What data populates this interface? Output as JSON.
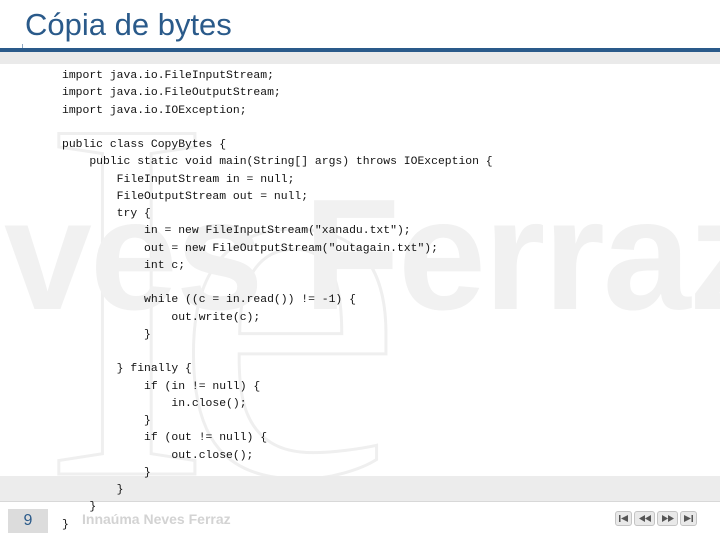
{
  "title": "Cópia de bytes",
  "code_lines": [
    "import java.io.FileInputStream;",
    "import java.io.FileOutputStream;",
    "import java.io.IOException;",
    "",
    "public class CopyBytes {",
    "    public static void main(String[] args) throws IOException {",
    "        FileInputStream in = null;",
    "        FileOutputStream out = null;",
    "        try {",
    "            in = new FileInputStream(\"xanadu.txt\");",
    "            out = new FileOutputStream(\"outagain.txt\");",
    "            int c;",
    "",
    "            while ((c = in.read()) != -1) {",
    "                out.write(c);",
    "            }",
    "",
    "        } finally {",
    "            if (in != null) {",
    "                in.close();",
    "            }",
    "            if (out != null) {",
    "                out.close();",
    "            }",
    "        }",
    "    }",
    "}"
  ],
  "footer": {
    "slide_number": "9",
    "author": "Innaúma Neves Ferraz"
  },
  "watermark": {
    "word": "ves Ferraz",
    "letters": "Ie"
  },
  "nav_icons": [
    "first-slide-icon",
    "previous-slide-icon",
    "next-slide-icon",
    "last-slide-icon"
  ],
  "colors": {
    "accent": "#2a5a8a",
    "footer_bar": "#ececec",
    "code_text": "#111111"
  }
}
